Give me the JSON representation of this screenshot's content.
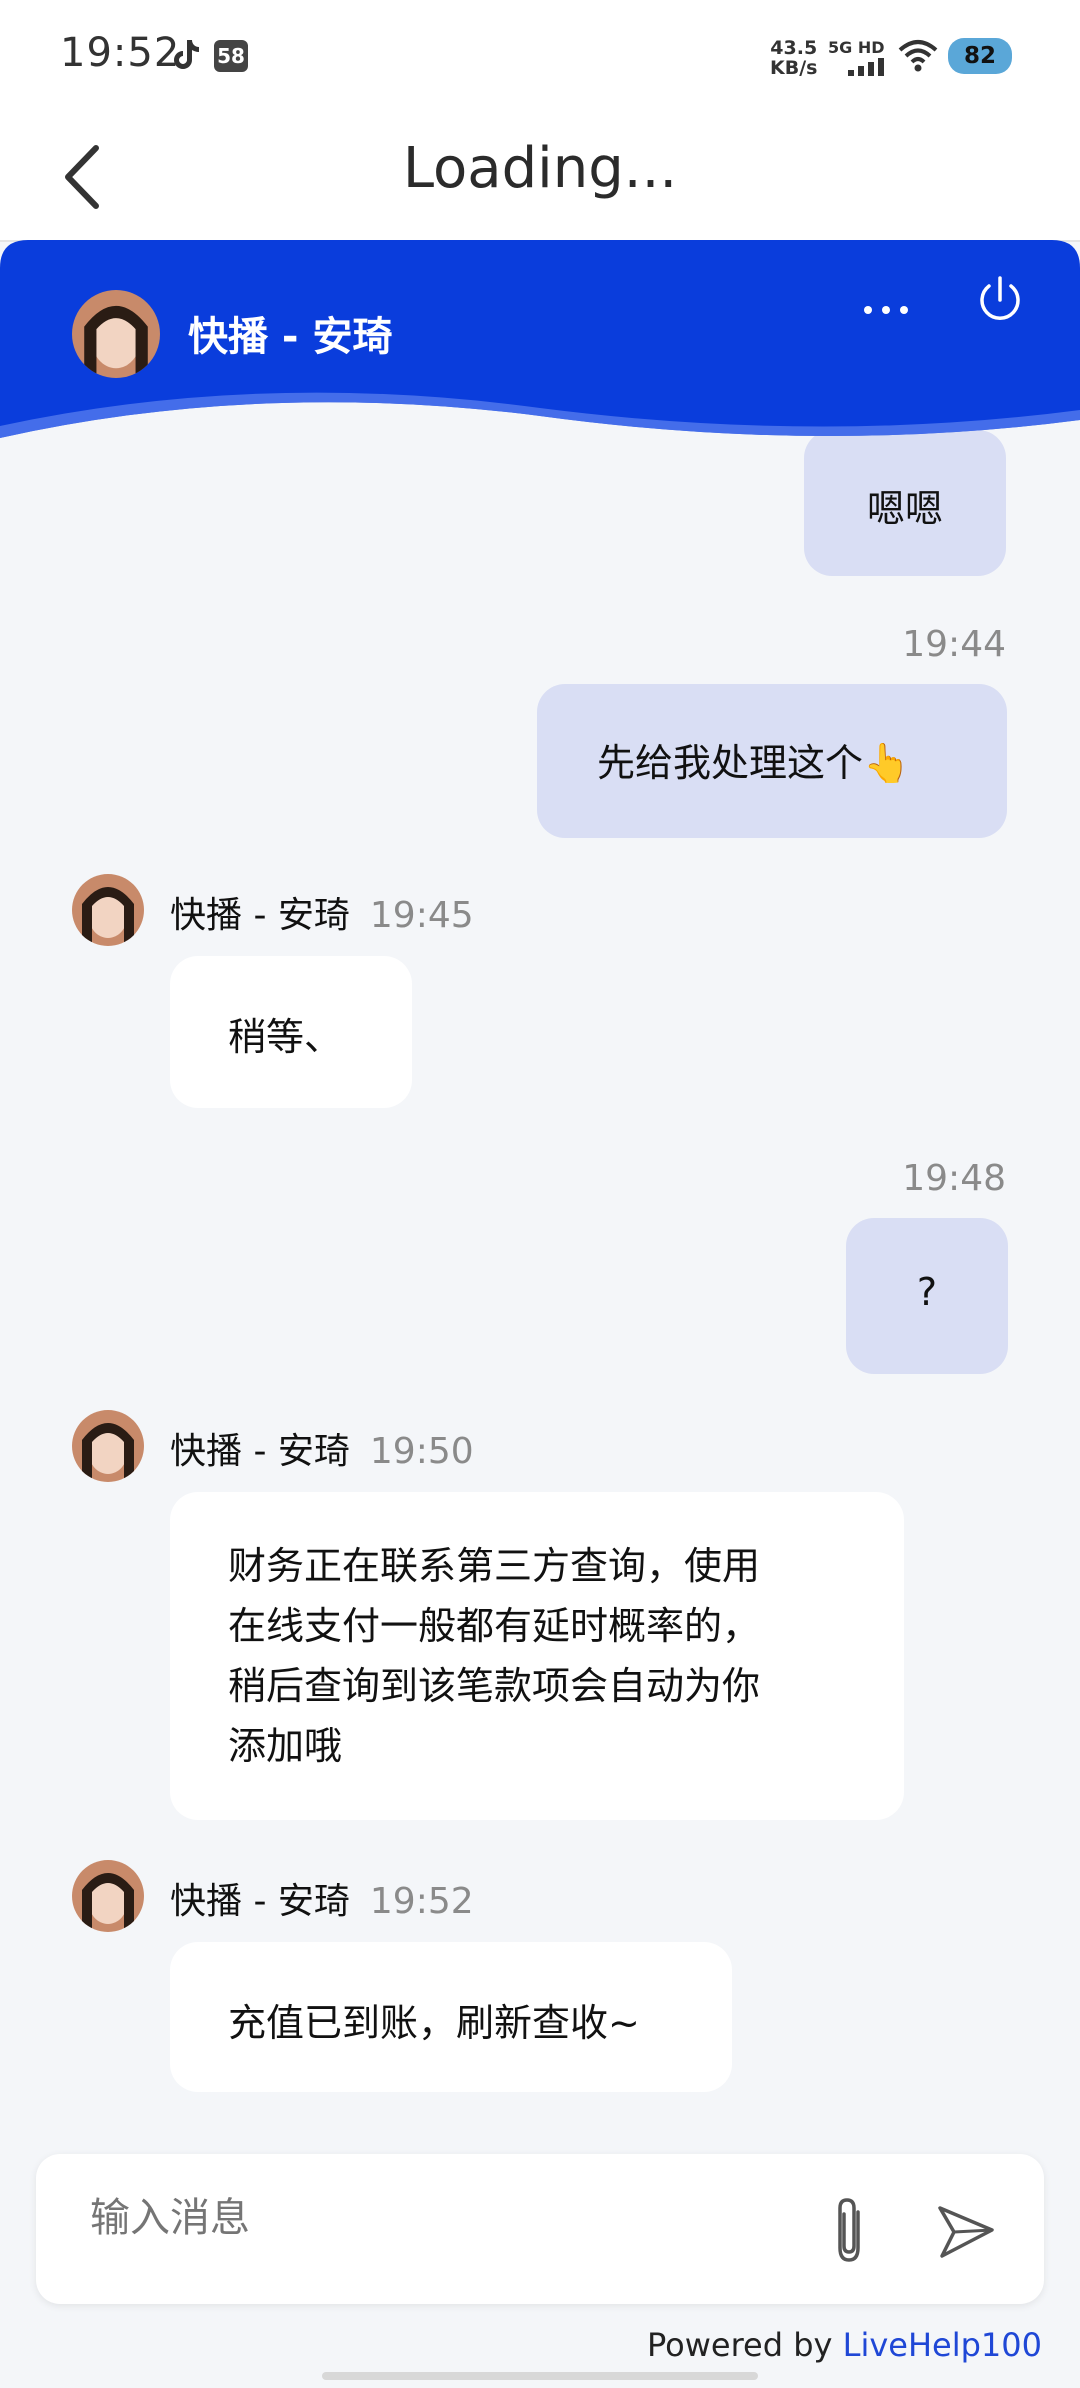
{
  "status_bar": {
    "time": "19:52",
    "badge": "58",
    "speed_value": "43.5",
    "speed_unit": "KB/s",
    "network": "5G HD",
    "battery": "82"
  },
  "nav": {
    "title": "Loading..."
  },
  "header": {
    "agent_name": "快播 - 安琦",
    "bg_color": "#0a3ddc"
  },
  "messages": [
    {
      "direction": "out",
      "time": "",
      "text": "嗯嗯"
    },
    {
      "direction": "out",
      "time": "19:44",
      "text": "先给我处理这个👆"
    },
    {
      "direction": "in",
      "sender": "快播 - 安琦",
      "time": "19:45",
      "text": "稍等、"
    },
    {
      "direction": "out",
      "time": "19:48",
      "text": "?"
    },
    {
      "direction": "in",
      "sender": "快播 - 安琦",
      "time": "19:50",
      "lines": [
        "财务正在联系第三方查询，使用",
        "在线支付一般都有延时概率的，",
        "稍后查询到该笔款项会自动为你",
        "添加哦"
      ]
    },
    {
      "direction": "in",
      "sender": "快播 - 安琦",
      "time": "19:52",
      "text": "充值已到账，刷新查收~"
    }
  ],
  "input": {
    "placeholder": "输入消息"
  },
  "footer": {
    "powered_prefix": "Powered by ",
    "brand": "LiveHelp100"
  }
}
